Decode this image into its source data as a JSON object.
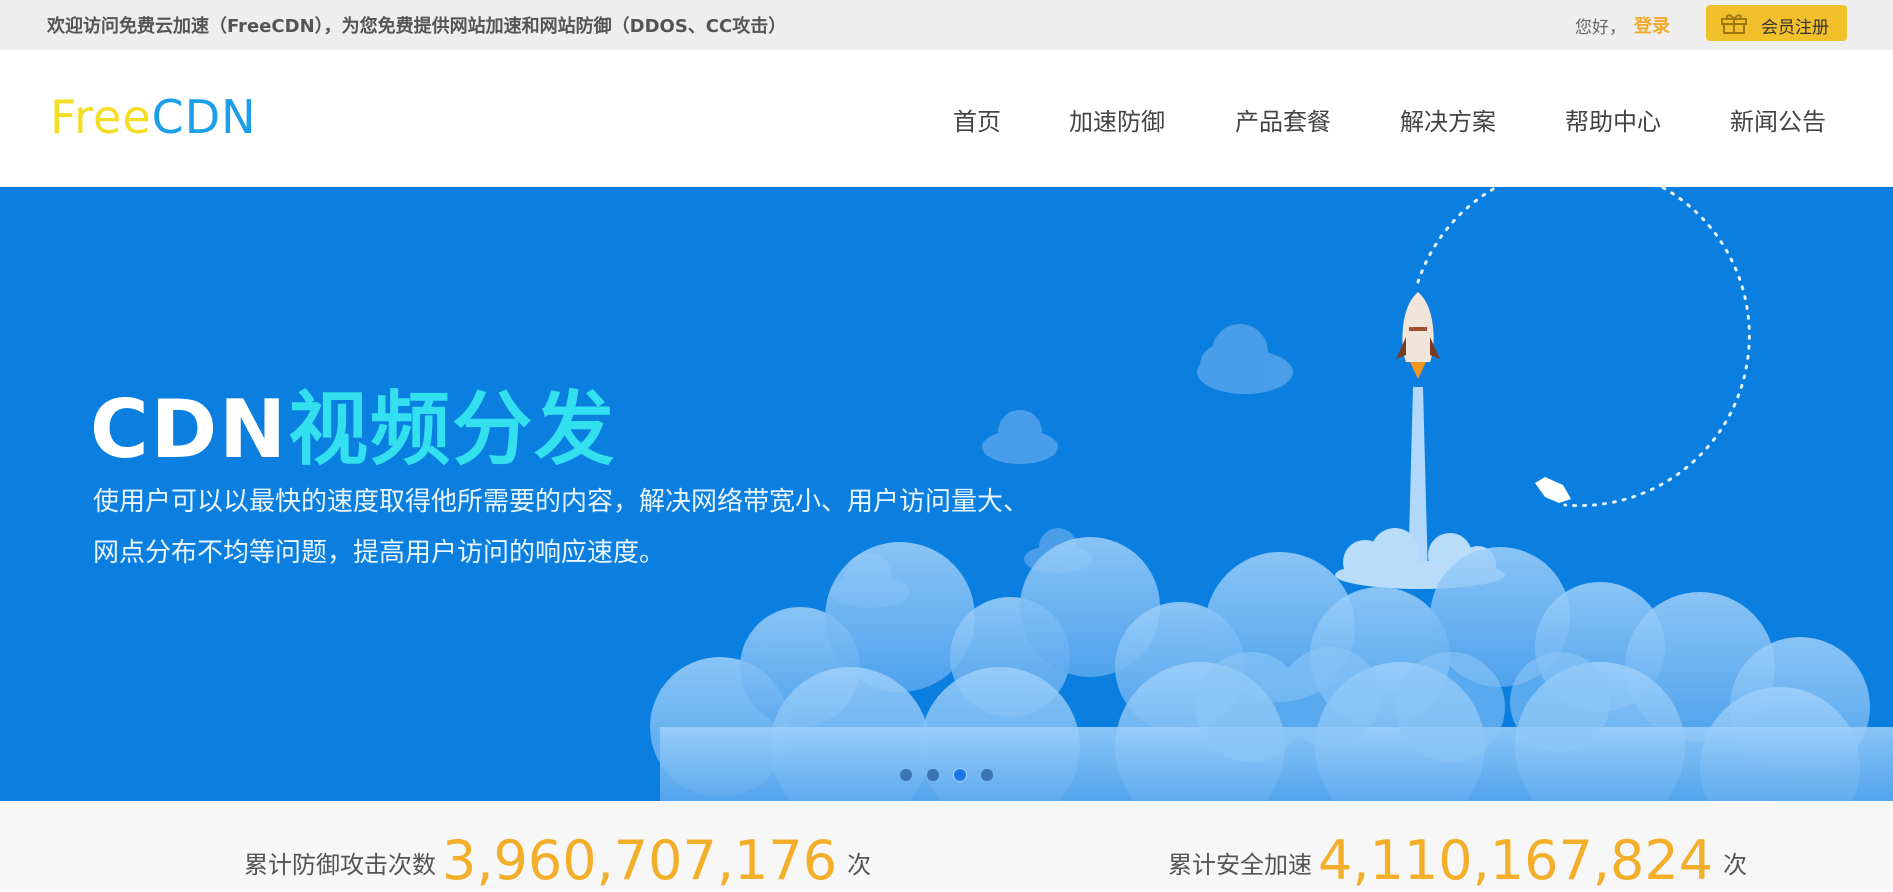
{
  "topbar": {
    "welcome": "欢迎访问免费云加速（FreeCDN），为您免费提供网站加速和网站防御（DDOS、CC攻击）",
    "greet": "您好，",
    "login": "登录",
    "register": "会员注册",
    "register_icon": "gift-icon"
  },
  "logo": {
    "part1": "Free",
    "part2": "CDN"
  },
  "nav": {
    "items": [
      {
        "label": "首页"
      },
      {
        "label": "加速防御"
      },
      {
        "label": "产品套餐"
      },
      {
        "label": "解决方案"
      },
      {
        "label": "帮助中心"
      },
      {
        "label": "新闻公告"
      }
    ]
  },
  "banner": {
    "headline_white": "CDN",
    "headline_cyan": "视频分发",
    "desc_line1": "使用户可以以最快的速度取得他所需要的内容，解决网络带宽小、用户访问量大、",
    "desc_line2": "网点分布不均等问题，提高用户访问的响应速度。",
    "active_slide": 3,
    "slide_count": 4,
    "colors": {
      "background": "#0a7fe0",
      "highlight": "#33e0f0",
      "accent": "#f3ae2a"
    }
  },
  "stats": {
    "defense": {
      "label": "累计防御攻击次数",
      "value": "3,960,707,176",
      "unit": "次"
    },
    "accel": {
      "label": "累计安全加速",
      "value": "4,110,167,824",
      "unit": "次"
    }
  }
}
